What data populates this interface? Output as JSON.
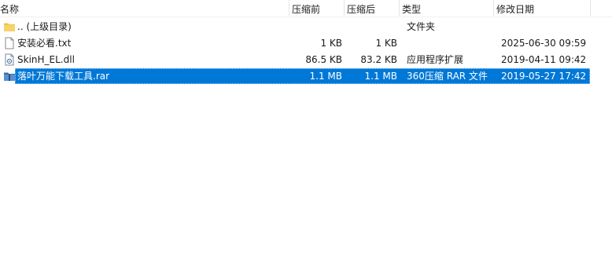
{
  "columns": {
    "name": "名称",
    "before": "压缩前",
    "after": "压缩后",
    "type": "类型",
    "modified": "修改日期"
  },
  "files": [
    {
      "name": ".. (上级目录)",
      "before": "",
      "after": "",
      "type": "文件夹",
      "modified": "",
      "icon": "folder-icon",
      "selected": false
    },
    {
      "name": "安装必看.txt",
      "before": "1 KB",
      "after": "1 KB",
      "type": "",
      "modified": "2025-06-30 09:59",
      "icon": "text-file-icon",
      "selected": false
    },
    {
      "name": "SkinH_EL.dll",
      "before": "86.5 KB",
      "after": "83.2 KB",
      "type": "应用程序扩展",
      "modified": "2019-04-11 09:42",
      "icon": "dll-file-icon",
      "selected": false
    },
    {
      "name": "落叶万能下载工具.rar",
      "before": "1.1 MB",
      "after": "1.1 MB",
      "type": "360压缩 RAR 文件",
      "modified": "2019-05-27 17:42",
      "icon": "rar-archive-icon",
      "selected": true
    }
  ],
  "colors": {
    "selection": "#0078d7",
    "folder": "#f3c24b"
  }
}
